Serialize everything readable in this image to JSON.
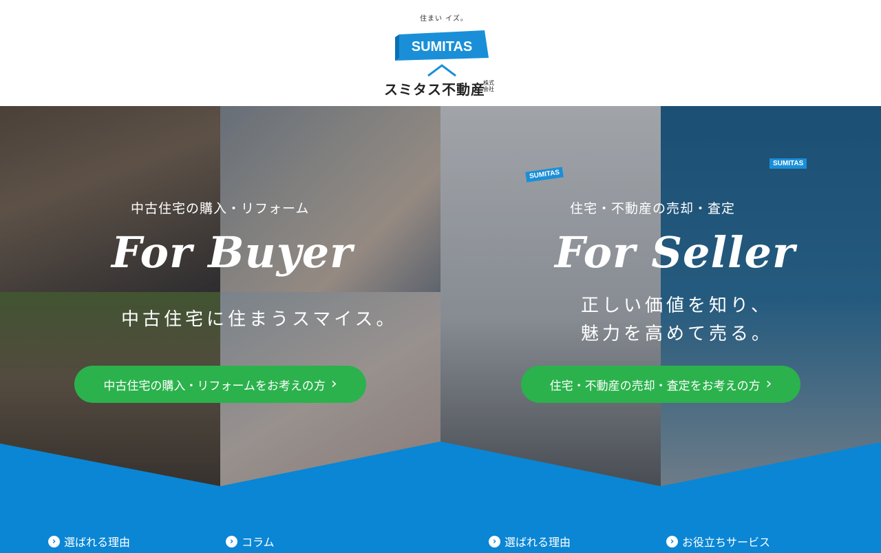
{
  "brand": {
    "tagline": "住まい イズ。",
    "banner_text": "SUMITAS",
    "name": "スミタス不動産",
    "suffix": "株式会社",
    "colors": {
      "blue": "#1a8fd8",
      "dark_blue": "#0a6fb5",
      "green": "#2bb24c",
      "band": "#0a86d4"
    }
  },
  "buyer": {
    "subtitle": "中古住宅の購入・リフォーム",
    "title": "For Buyer",
    "catch": "中古住宅に住まうスマイス。",
    "cta_label": "中古住宅の購入・リフォームをお考えの方",
    "cta_icon": "chevron-right-icon"
  },
  "seller": {
    "subtitle": "住宅・不動産の売却・査定",
    "title": "For Seller",
    "catch_line1": "正しい価値を知り、",
    "catch_line2": "魅力を高めて売る。",
    "cta_label": "住宅・不動産の売却・査定をお考えの方",
    "cta_icon": "chevron-right-icon",
    "badge_left": "SUMITAS",
    "badge_right": "SUMITAS"
  },
  "bottom_nav": [
    {
      "label": "選ばれる理由",
      "icon": "chevron-circle-icon"
    },
    {
      "label": "コラム",
      "icon": "chevron-circle-icon"
    },
    {
      "label": "選ばれる理由",
      "icon": "chevron-circle-icon"
    },
    {
      "label": "お役立ちサービス",
      "icon": "chevron-circle-icon"
    }
  ]
}
